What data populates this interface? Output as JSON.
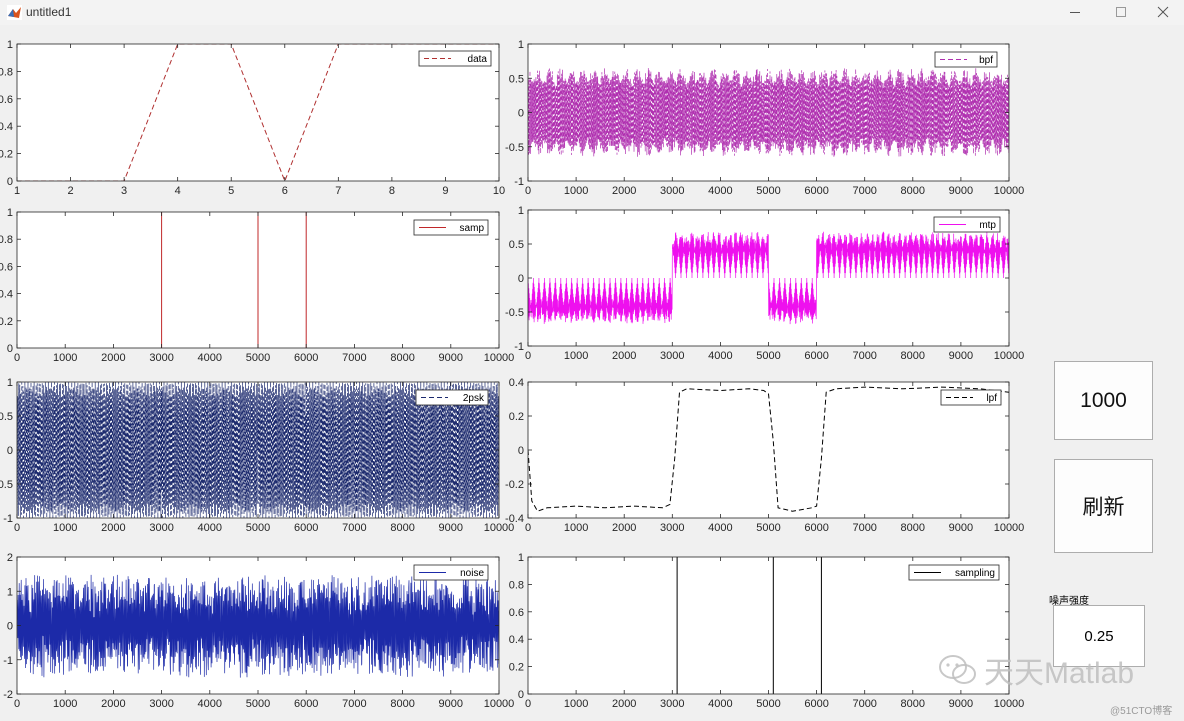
{
  "window": {
    "title": "untitled1",
    "minimize_icon": "minimize-icon",
    "maximize_icon": "maximize-icon",
    "close_icon": "close-icon"
  },
  "controls": {
    "count_button_label": "1000",
    "refresh_button_label": "刷新",
    "noise_label": "噪声强度",
    "noise_value": "0.25"
  },
  "watermark": {
    "text": "天天Matlab",
    "icon": "wechat-icon",
    "site": "@51CTO博客"
  },
  "colors": {
    "data": "#b03030",
    "samp": "#c0282a",
    "psk": "#1c2a6e",
    "noise": "#1c2aa8",
    "bpf": "#b030b0",
    "mtp": "#ee10ee",
    "lpf": "#000000",
    "sampling": "#000000"
  },
  "chart_data": [
    {
      "id": "data",
      "type": "line",
      "legend": "data",
      "style": "dashed",
      "x": [
        1,
        2,
        3,
        4,
        5,
        6,
        7,
        8,
        9,
        10
      ],
      "y": [
        0,
        0,
        0,
        1,
        1,
        0,
        1,
        1,
        1,
        1
      ],
      "xlim": [
        1,
        10
      ],
      "ylim": [
        0,
        1
      ],
      "xticks": [
        "1",
        "2",
        "3",
        "4",
        "5",
        "6",
        "7",
        "8",
        "9",
        "10"
      ],
      "yticks": [
        "0",
        "0.2",
        "0.4",
        "0.6",
        "0.8",
        "1"
      ]
    },
    {
      "id": "samp",
      "type": "line",
      "legend": "samp",
      "style": "impulse",
      "impulses": [
        3000,
        5000,
        6000
      ],
      "height": 1,
      "xlim": [
        0,
        10000
      ],
      "ylim": [
        0,
        1
      ],
      "xticks": [
        "0",
        "1000",
        "2000",
        "3000",
        "4000",
        "5000",
        "6000",
        "7000",
        "8000",
        "9000",
        "10000"
      ],
      "yticks": [
        "0",
        "0.2",
        "0.4",
        "0.6",
        "0.8",
        "1"
      ]
    },
    {
      "id": "2psk",
      "type": "line",
      "legend": "2psk",
      "style": "dashed",
      "signal": "carrier",
      "amplitude": 1,
      "cycles": 110,
      "xlim": [
        0,
        10000
      ],
      "ylim": [
        -1,
        1
      ],
      "xticks": [
        "0",
        "1000",
        "2000",
        "3000",
        "4000",
        "5000",
        "6000",
        "7000",
        "8000",
        "9000",
        "10000"
      ],
      "yticks": [
        "-1",
        "-0.5",
        "0",
        "0.5",
        "1"
      ]
    },
    {
      "id": "noise",
      "type": "line",
      "legend": "noise",
      "style": "solid",
      "signal": "noisy-carrier",
      "amplitude": 1.3,
      "cycles": 160,
      "xlim": [
        0,
        10000
      ],
      "ylim": [
        -2,
        2
      ],
      "xticks": [
        "0",
        "1000",
        "2000",
        "3000",
        "4000",
        "5000",
        "6000",
        "7000",
        "8000",
        "9000",
        "10000"
      ],
      "yticks": [
        "-2",
        "-1",
        "0",
        "1",
        "2"
      ]
    },
    {
      "id": "bpf",
      "type": "line",
      "legend": "bpf",
      "style": "dashed",
      "signal": "filtered-carrier",
      "amplitude": 0.65,
      "cycles": 170,
      "xlim": [
        0,
        10000
      ],
      "ylim": [
        -1,
        1
      ],
      "xticks": [
        "0",
        "1000",
        "2000",
        "3000",
        "4000",
        "5000",
        "6000",
        "7000",
        "8000",
        "9000",
        "10000"
      ],
      "yticks": [
        "-1",
        "-0.5",
        "0",
        "0.5",
        "1"
      ]
    },
    {
      "id": "mtp",
      "type": "line",
      "legend": "mtp",
      "style": "solid",
      "signal": "rectified",
      "levels": [
        {
          "from": 0,
          "to": 3000,
          "sign": -1
        },
        {
          "from": 3000,
          "to": 5000,
          "sign": 1
        },
        {
          "from": 5000,
          "to": 6000,
          "sign": -1
        },
        {
          "from": 6000,
          "to": 10000,
          "sign": 1
        }
      ],
      "amplitude": 0.65,
      "xlim": [
        0,
        10000
      ],
      "ylim": [
        -1,
        1
      ],
      "xticks": [
        "0",
        "1000",
        "2000",
        "3000",
        "4000",
        "5000",
        "6000",
        "7000",
        "8000",
        "9000",
        "10000"
      ],
      "yticks": [
        "-1",
        "-0.5",
        "0",
        "0.5",
        "1"
      ]
    },
    {
      "id": "lpf",
      "type": "line",
      "legend": "lpf",
      "style": "dashed",
      "signal": "step",
      "x": [
        0,
        80,
        200,
        400,
        1000,
        1600,
        2200,
        2800,
        2950,
        3050,
        3150,
        3300,
        4000,
        4600,
        4900,
        5000,
        5100,
        5200,
        5500,
        5900,
        6000,
        6100,
        6200,
        6400,
        7000,
        7800,
        8600,
        9400,
        10000
      ],
      "y": [
        0.0,
        -0.3,
        -0.36,
        -0.34,
        -0.33,
        -0.34,
        -0.33,
        -0.34,
        -0.32,
        -0.05,
        0.34,
        0.36,
        0.35,
        0.36,
        0.35,
        0.33,
        0.05,
        -0.34,
        -0.36,
        -0.34,
        -0.33,
        -0.05,
        0.34,
        0.36,
        0.37,
        0.36,
        0.37,
        0.36,
        0.34
      ],
      "xlim": [
        0,
        10000
      ],
      "ylim": [
        -0.4,
        0.4
      ],
      "xticks": [
        "0",
        "1000",
        "2000",
        "3000",
        "4000",
        "5000",
        "6000",
        "7000",
        "8000",
        "9000",
        "10000"
      ],
      "yticks": [
        "-0.4",
        "-0.2",
        "0",
        "0.2",
        "0.4"
      ]
    },
    {
      "id": "sampling",
      "type": "line",
      "legend": "sampling",
      "style": "impulse",
      "impulses": [
        3100,
        5100,
        6100
      ],
      "height": 1,
      "xlim": [
        0,
        10000
      ],
      "ylim": [
        0,
        1
      ],
      "xticks": [
        "0",
        "1000",
        "2000",
        "3000",
        "4000",
        "5000",
        "6000",
        "7000",
        "8000",
        "9000",
        "10000"
      ],
      "yticks": [
        "0",
        "0.2",
        "0.4",
        "0.6",
        "0.8",
        "1"
      ]
    }
  ]
}
